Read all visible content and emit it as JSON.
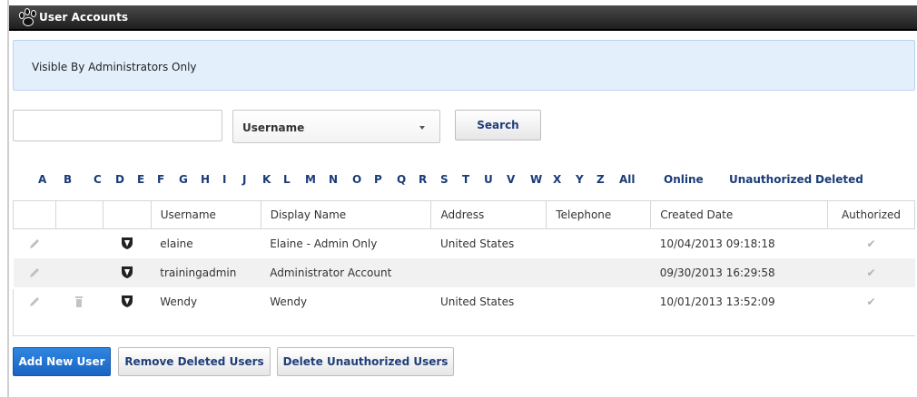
{
  "window": {
    "title": "User Accounts"
  },
  "notice": {
    "text": "Visible By Administrators Only"
  },
  "search": {
    "input_value": "",
    "filter_selected": "Username",
    "button_label": "Search"
  },
  "alphabet": {
    "letters": [
      "A",
      "B",
      "C",
      "D",
      "E",
      "F",
      "G",
      "H",
      "I",
      "J",
      "K",
      "L",
      "M",
      "N",
      "O",
      "P",
      "Q",
      "R",
      "S",
      "T",
      "U",
      "V",
      "W",
      "X",
      "Y",
      "Z"
    ],
    "filters": [
      "All",
      "Online",
      "Unauthorized",
      "Deleted"
    ]
  },
  "table": {
    "columns": [
      "",
      "",
      "",
      "Username",
      "Display Name",
      "Address",
      "Telephone",
      "Created Date",
      "Authorized"
    ],
    "rows": [
      {
        "username": "elaine",
        "display_name": "Elaine - Admin Only",
        "address": "United States",
        "telephone": "",
        "created": "10/04/2013 09:18:18",
        "deletable": false
      },
      {
        "username": "trainingadmin",
        "display_name": "Administrator Account",
        "address": "",
        "telephone": "",
        "created": "09/30/2013 16:29:58",
        "deletable": false
      },
      {
        "username": "Wendy",
        "display_name": "Wendy",
        "address": "United States",
        "telephone": "",
        "created": "10/01/2013 13:52:09",
        "deletable": true
      }
    ],
    "icons": {
      "edit": "pencil-icon",
      "delete": "trash-icon",
      "role": "shield-icon",
      "authorized": "check-icon"
    }
  },
  "actions": {
    "add_label": "Add New User",
    "remove_label": "Remove Deleted Users",
    "delete_label": "Delete Unauthorized Users"
  },
  "colors": {
    "titlebar": "#2b2b2b",
    "notice_bg": "#e3f0fc",
    "link": "#1a3b78",
    "primary_button": "#1f72d2"
  }
}
